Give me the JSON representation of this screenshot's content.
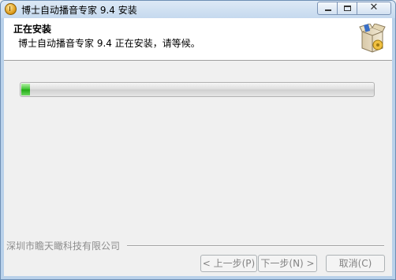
{
  "window": {
    "title": "博士自动播音专家 9.4 安装",
    "icon": "installer-app-icon"
  },
  "caption_buttons": {
    "minimize": "minimize-icon",
    "maximize": "maximize-icon",
    "close": "✕"
  },
  "header": {
    "title": "正在安装",
    "subtitle": "博士自动播音专家 9.4 正在安装，请等候。",
    "icon": "installer-box-icon"
  },
  "progress": {
    "percent": 3
  },
  "footer": {
    "brand": "深圳市瞻天瞰科技有限公司",
    "back_label": "< 上一步(P)",
    "next_label": "下一步(N) >",
    "cancel_label": "取消(C)"
  },
  "colors": {
    "progress_fill": "#37c22a",
    "disabled_text": "#838383",
    "brand_text": "#8d8d8d"
  }
}
